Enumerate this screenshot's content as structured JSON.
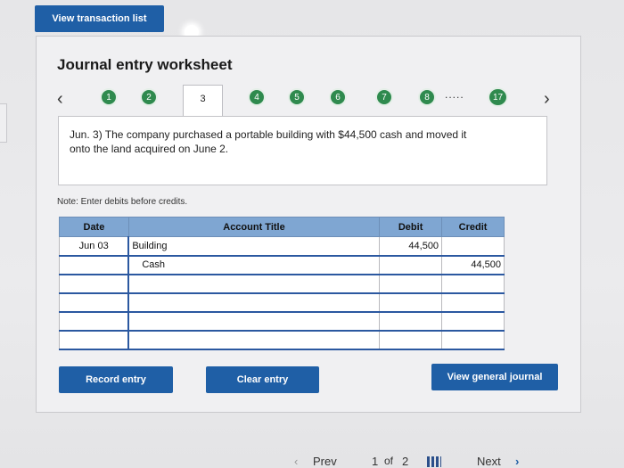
{
  "header": {
    "view_transaction_list": "View transaction list"
  },
  "worksheet": {
    "title": "Journal entry worksheet",
    "steps": [
      "1",
      "2",
      "3",
      "4",
      "5",
      "6",
      "7",
      "8",
      "17"
    ],
    "active_step": "3",
    "ellipsis": ".....",
    "description": "Jun. 3) The company purchased a portable building with $44,500 cash and moved it onto the land acquired on June 2.",
    "note": "Note: Enter debits before credits.",
    "table": {
      "headers": {
        "date": "Date",
        "account": "Account Title",
        "debit": "Debit",
        "credit": "Credit"
      },
      "rows": [
        {
          "date": "Jun 03",
          "account": "Building",
          "debit": "44,500",
          "credit": ""
        },
        {
          "date": "",
          "account": "Cash",
          "debit": "",
          "credit": "44,500"
        },
        {
          "date": "",
          "account": "",
          "debit": "",
          "credit": ""
        },
        {
          "date": "",
          "account": "",
          "debit": "",
          "credit": ""
        },
        {
          "date": "",
          "account": "",
          "debit": "",
          "credit": ""
        },
        {
          "date": "",
          "account": "",
          "debit": "",
          "credit": ""
        }
      ]
    },
    "buttons": {
      "record": "Record entry",
      "clear": "Clear entry",
      "view_general_journal": "View general journal"
    }
  },
  "footer": {
    "prev": "Prev",
    "page": "1",
    "of": "of",
    "total": "2",
    "next": "Next"
  },
  "colors": {
    "primary": "#1f5fa6",
    "step_done": "#2f8a4e",
    "table_header": "#7fa6d2"
  }
}
